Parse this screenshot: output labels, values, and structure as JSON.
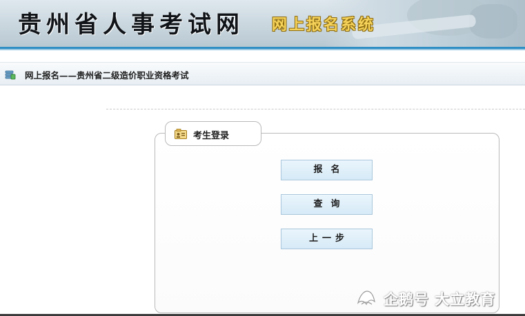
{
  "banner": {
    "title": "贵州省人事考试网",
    "subtitle": "网上报名系统"
  },
  "breadcrumb": {
    "text": "网上报名——贵州省二级造价职业资格考试",
    "icon": "database-icon"
  },
  "panel": {
    "tab_label": "考生登录",
    "tab_icon": "id-card-icon",
    "buttons": {
      "register": "报名",
      "query": "查询",
      "back": "上一步"
    }
  },
  "watermark": {
    "text": "企鹅号 大立教育",
    "icon": "penguin-logo-icon"
  },
  "colors": {
    "banner_accent": "#2f8fc4",
    "subtitle_gold": "#f6d35a",
    "button_fill": "#d6eaf7",
    "button_border": "#a9c7dc"
  }
}
